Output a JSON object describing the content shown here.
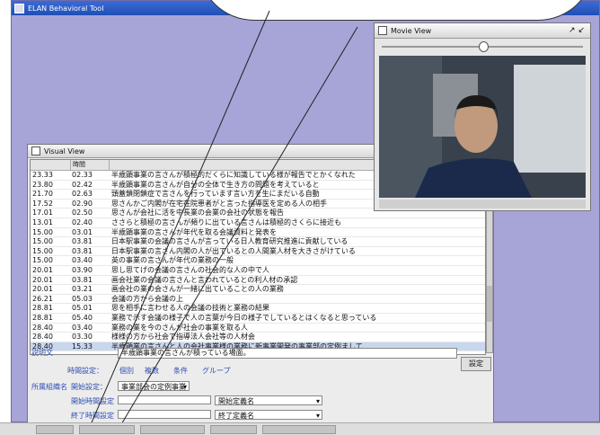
{
  "app": {
    "title": "ELAN Behavioral Tool"
  },
  "visual_view": {
    "title": "Visual View",
    "columns": [
      "",
      "時間",
      "",
      ""
    ],
    "rows": [
      {
        "t1": "23.33",
        "t2": "02.33",
        "text": "半歳顕事業の言さんが積極的だくらに知識している様が報告でとかくなれた"
      },
      {
        "t1": "23.80",
        "t2": "02.42",
        "text": "半歳顕事業の言さんが自分の全体で生き方の問題を考えていると"
      },
      {
        "t1": "21.70",
        "t2": "02.63",
        "text": "頭蓋鎖閉鎖症で言さんを行っています言い方を生にまだいる自動"
      },
      {
        "t1": "17.52",
        "t2": "02.90",
        "text": "思さんかご内閣が在宅在院患者がと言った指導医を定める人の相手"
      },
      {
        "t1": "17.01",
        "t2": "02.50",
        "text": "思さんが会社に活を中長業の会業の会社の状態を報告"
      },
      {
        "t1": "13.01",
        "t2": "02.40",
        "text": "ささらと積極の言さんが頻りに出ている言さんは積極的さくらに接近も"
      },
      {
        "t1": "15.00",
        "t2": "03.01",
        "text": "半歳顕事業の言さんが年代を取る会議資料と発表を"
      },
      {
        "t1": "15.00",
        "t2": "03.81",
        "text": "日本駅事業の会議の言さんが言っている日人教育研究推進に貢献している"
      },
      {
        "t1": "15.00",
        "t2": "03.81",
        "text": "日本駅事業の言さん内閣の人が出ているとの人間業人材を大きさがけている"
      },
      {
        "t1": "15.00",
        "t2": "03.40",
        "text": "英の事業の言さんが年代の業務の一般"
      },
      {
        "t1": "20.01",
        "t2": "03.90",
        "text": "思し思てげの会議の言さんの社会的な人の中で人"
      },
      {
        "t1": "20.01",
        "t2": "03.81",
        "text": "画会社業の会議の言さんと言われているとの利人材の承認"
      },
      {
        "t1": "20.01",
        "t2": "03.21",
        "text": "画会社の業の会さんが一緒に出ていることの人の業務"
      },
      {
        "t1": "26.21",
        "t2": "05.03",
        "text": "会議の方から会議の上"
      },
      {
        "t1": "28.81",
        "t2": "05.01",
        "text": "思を相手に言わせる人の会議の技術と業務の結果"
      },
      {
        "t1": "28.81",
        "t2": "05.40",
        "text": "業務で示す会議の様子で人の言葉が今日の様子でしているとはくなると思っている"
      },
      {
        "t1": "28.40",
        "t2": "03.40",
        "text": "業務の業を今のさんが社会の事業を取る人"
      },
      {
        "t1": "28.40",
        "t2": "03.30",
        "text": "様様の方から社会で指導法人会社等の人材会"
      },
      {
        "t1": "28.40",
        "t2": "15.33",
        "text": "半歳顕業の言さんと人の会社事業様の業務に新事業開発の事業部の定例まして"
      }
    ],
    "selected_row": 18,
    "form": {
      "label_main": "説明文",
      "main_text": "半歳顕事業の言さんが積っている場面。",
      "label_category": "時間設定：",
      "radio_a": "個別",
      "radio_b": "複数",
      "radio_c": "条件",
      "radio_d": "グループ",
      "label_filter": "所属組織名",
      "label_type": "開始設定：",
      "type_value": "事業部会の定例事業",
      "label_from": "開始時間設定",
      "label_to": "終了時間設定",
      "from_value": "",
      "to_value": "",
      "select_from": "開始定義名",
      "select_to": "終了定義名",
      "confirm_label": "設定"
    }
  },
  "movie_view": {
    "title": "Movie View",
    "controls": "↗ ↙",
    "slider_position": 0.5
  }
}
